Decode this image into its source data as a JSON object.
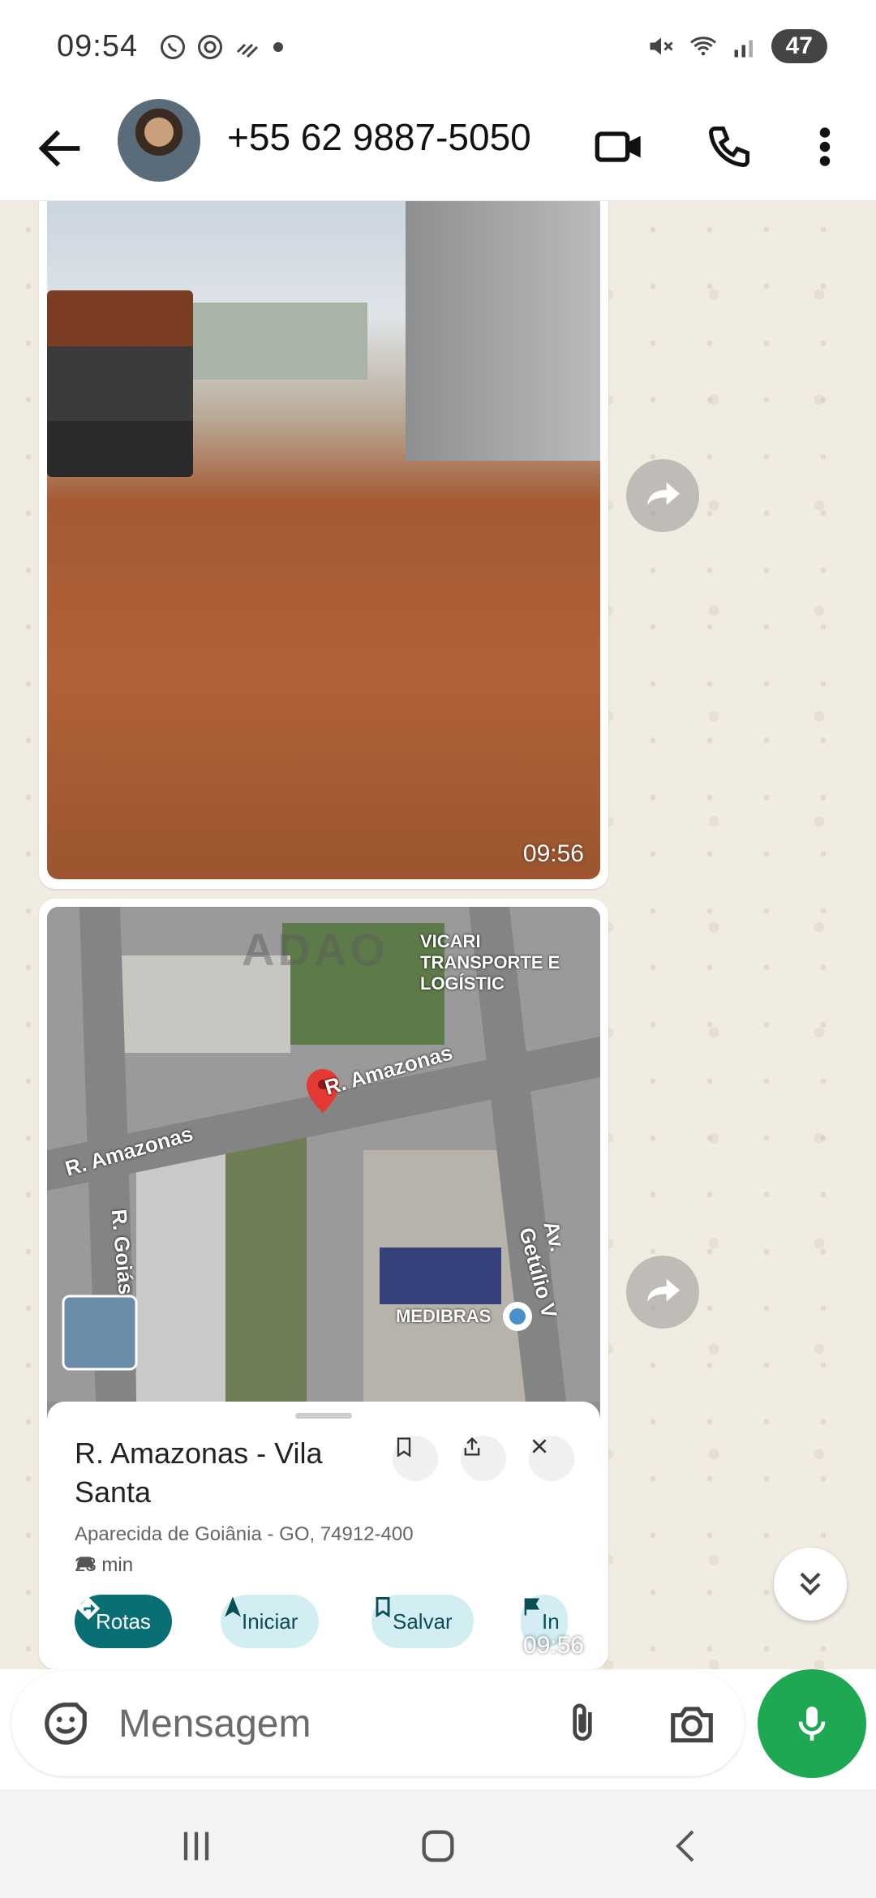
{
  "status_bar": {
    "time": "09:54",
    "battery": "47",
    "left_icons": [
      "whatsapp-icon",
      "threads-icon",
      "signal-slash-icon",
      "dot-icon"
    ],
    "right_icons": [
      "mute-icon",
      "wifi-icon",
      "cell-signal-icon"
    ]
  },
  "header": {
    "contact_name": "+55 62 9887-5050",
    "icons": [
      "back-arrow-icon",
      "video-call-icon",
      "phone-icon",
      "more-vert-icon"
    ]
  },
  "messages": [
    {
      "type": "image",
      "timestamp": "09:56"
    },
    {
      "type": "map-screenshot",
      "map_labels": {
        "poi": "VICARI TRANSPORTE E LOGÍSTIC",
        "street_1": "R. Amazonas",
        "street_2": "R. Amazonas",
        "street_3": "R. Goiás",
        "avenue": "Av. Getúlio V",
        "business": "MEDIBRAS",
        "watermark": "ADAO"
      },
      "place_card": {
        "title": "R. Amazonas - Vila Santa",
        "address": "Aparecida de Goiânia - GO, 74912-400",
        "eta": "23 min",
        "actions": [
          "Rotas",
          "Iniciar",
          "Salvar",
          "In"
        ]
      },
      "timestamp": "09:56"
    }
  ],
  "composer": {
    "placeholder": "Mensagem"
  },
  "colors": {
    "accent_green": "#1da851",
    "maps_primary": "#0a6e75",
    "maps_chip": "#d3eef3",
    "chat_bg": "#f1ece2"
  }
}
